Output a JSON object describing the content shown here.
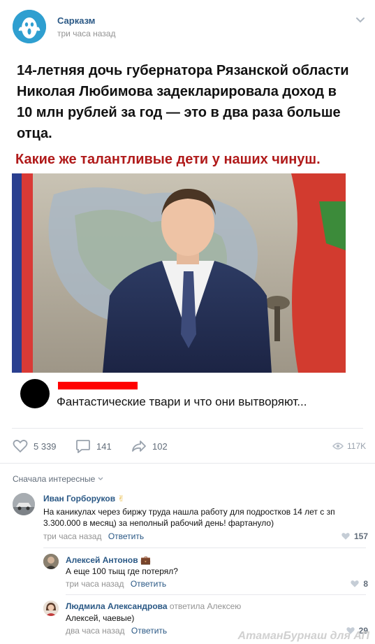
{
  "post": {
    "group_name": "Сарказм",
    "time": "три часа назад",
    "headline": "14-летняя дочь губернатора Рязанской области Николая Любимова задекларировала доход в 10 млн рублей за год — это в два раза больше отца.",
    "sub_headline": "Какие же талантливые дети у наших чинуш.",
    "caption": "Фантастические твари и что они вытворяют..."
  },
  "actions": {
    "likes": "5 339",
    "comments": "141",
    "shares": "102",
    "views": "117K"
  },
  "comments_section": {
    "sort_label": "Сначала интересные"
  },
  "comments": [
    {
      "author": "Иван Горборуков",
      "author_emoji": "✌",
      "text": "На каникулах через биржу труда нашла работу для подростков 14 лет с зп 3.300.000 в месяц) за неполный рабочий день! фартануло)",
      "time": "три часа назад",
      "reply_label": "Ответить",
      "likes": "157"
    },
    {
      "author": "Алексей Антонов",
      "author_emoji": "💼",
      "text": "А еще 100 тыщ где потерял?",
      "time": "три часа назад",
      "reply_label": "Ответить",
      "likes": "8"
    },
    {
      "author": "Людмила Александрова",
      "reply_to": "ответила Алексею",
      "text": "Алексей, чаевые)",
      "time": "два часа назад",
      "reply_label": "Ответить",
      "likes": "29"
    }
  ],
  "watermark": "АтаманБурнаш для АП"
}
